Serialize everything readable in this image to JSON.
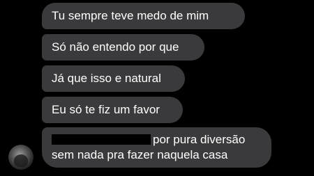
{
  "conversation": {
    "messages": [
      {
        "text": "Tu sempre teve medo de mim"
      },
      {
        "text": "Só não entendo por que"
      },
      {
        "text": "Já que isso e natural"
      },
      {
        "text": "Eu só te fiz um favor"
      },
      {
        "text": "por pura diversão sem nada pra fazer naquela casa"
      }
    ],
    "avatar_icon": "user-avatar-photo",
    "colors": {
      "background": "#000000",
      "bubble": "#3a3a3c",
      "text": "#ffffff"
    }
  }
}
